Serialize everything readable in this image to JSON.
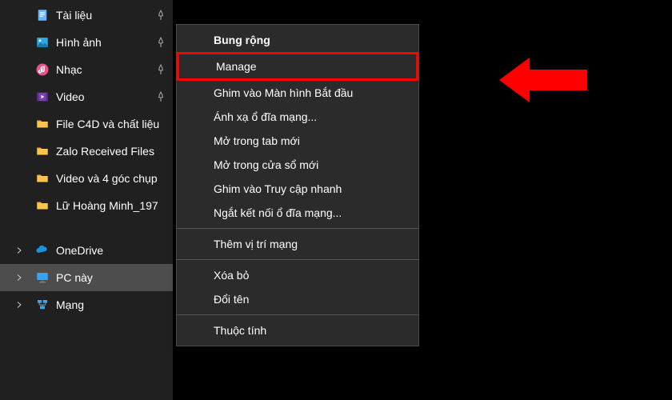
{
  "sidebar": {
    "pinned": [
      {
        "label": "Tài liệu",
        "icon": "document-icon",
        "pin": true
      },
      {
        "label": "Hình ảnh",
        "icon": "picture-icon",
        "pin": true
      },
      {
        "label": "Nhạc",
        "icon": "music-icon",
        "pin": true
      },
      {
        "label": "Video",
        "icon": "video-icon",
        "pin": true
      },
      {
        "label": "File C4D và chất liệu",
        "icon": "folder-icon",
        "pin": false
      },
      {
        "label": "Zalo Received Files",
        "icon": "folder-icon",
        "pin": false
      },
      {
        "label": "Video và 4 góc chụp",
        "icon": "folder-icon",
        "pin": false
      },
      {
        "label": "Lữ Hoàng Minh_197",
        "icon": "folder-icon",
        "pin": false
      }
    ],
    "tree": [
      {
        "label": "OneDrive",
        "icon": "cloud-icon",
        "expandable": true,
        "selected": false
      },
      {
        "label": "PC này",
        "icon": "monitor-icon",
        "expandable": true,
        "selected": true
      },
      {
        "label": "Mạng",
        "icon": "network-icon",
        "expandable": true,
        "selected": false
      }
    ]
  },
  "context_menu": {
    "groups": [
      [
        {
          "label": "Bung rộng",
          "bold": true
        },
        {
          "label": "Manage",
          "highlighted": true
        },
        {
          "label": "Ghim vào Màn hình Bắt đầu"
        },
        {
          "label": "Ánh xạ ổ đĩa mạng..."
        },
        {
          "label": "Mở trong tab mới"
        },
        {
          "label": "Mở trong cửa sổ mới"
        },
        {
          "label": "Ghim vào Truy cập nhanh"
        },
        {
          "label": "Ngắt kết nối ổ đĩa mạng..."
        }
      ],
      [
        {
          "label": "Thêm vị trí mạng"
        }
      ],
      [
        {
          "label": "Xóa bỏ"
        },
        {
          "label": "Đổi tên"
        }
      ],
      [
        {
          "label": "Thuộc tính"
        }
      ]
    ]
  },
  "annotation": {
    "arrow_color": "#ff0000"
  }
}
